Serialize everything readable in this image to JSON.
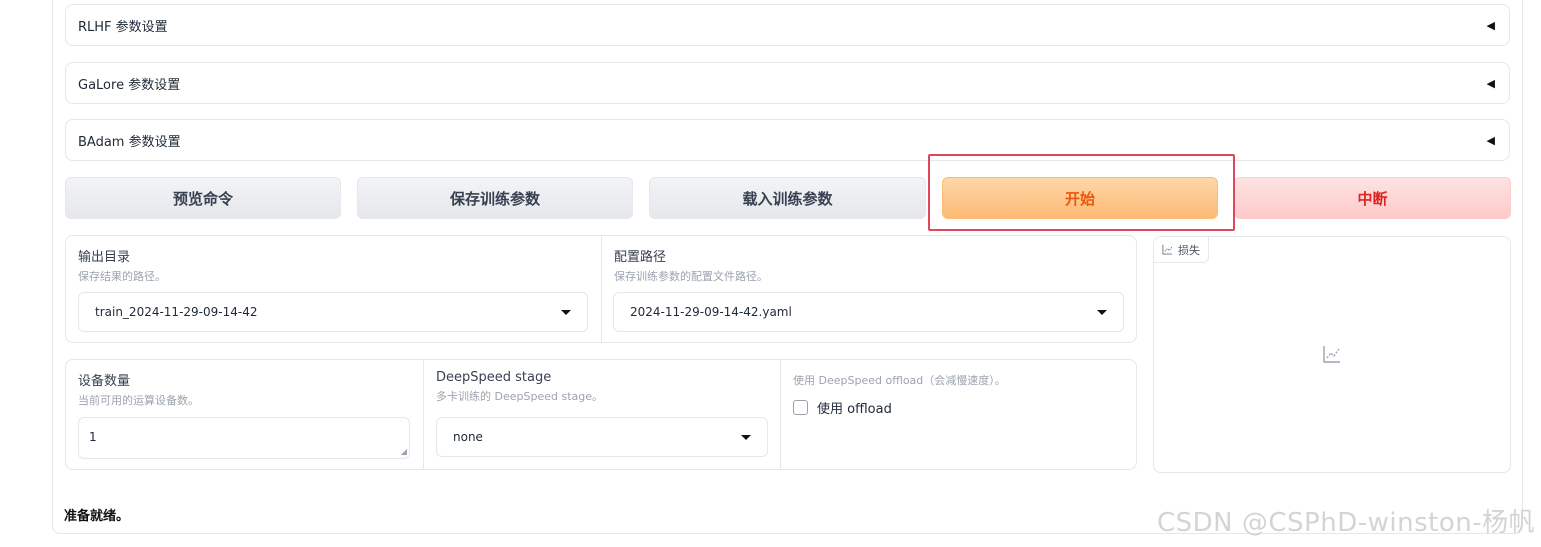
{
  "accordions": [
    {
      "label": "RLHF 参数设置",
      "arrow": "◀"
    },
    {
      "label": "GaLore 参数设置",
      "arrow": "◀"
    },
    {
      "label": "BAdam 参数设置",
      "arrow": "◀"
    }
  ],
  "buttons": {
    "preview": "预览命令",
    "save": "保存训练参数",
    "load": "载入训练参数",
    "start": "开始",
    "abort": "中断"
  },
  "output_dir": {
    "label": "输出目录",
    "info": "保存结果的路径。",
    "value": "train_2024-11-29-09-14-42"
  },
  "config_path": {
    "label": "配置路径",
    "info": "保存训练参数的配置文件路径。",
    "value": "2024-11-29-09-14-42.yaml"
  },
  "device_count": {
    "label": "设备数量",
    "info": "当前可用的运算设备数。",
    "value": "1"
  },
  "ds_stage": {
    "label": "DeepSpeed stage",
    "info": "多卡训练的 DeepSpeed stage。",
    "value": "none"
  },
  "ds_offload": {
    "info": "使用 DeepSpeed offload（会减慢速度）。",
    "label": "使用 offload",
    "checked": false
  },
  "loss_plot": {
    "label": "损失",
    "icon": "chart-icon"
  },
  "status": "准备就绪。",
  "watermark": "CSDN @CSPhD-winston-杨帆",
  "colors": {
    "primary": "#fdba74",
    "primary_text": "#ea580c",
    "stop": "#fecaca",
    "stop_text": "#dc2626",
    "highlight_border": "#e0475c"
  }
}
